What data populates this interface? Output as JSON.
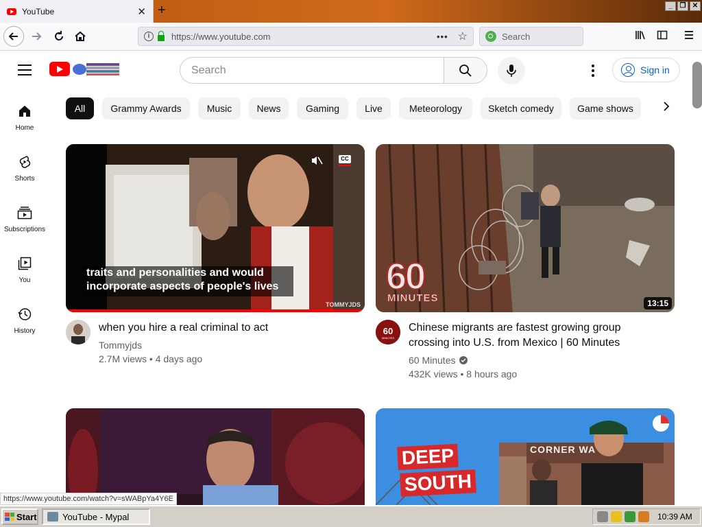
{
  "browser": {
    "tab_title": "YouTube",
    "url": "https://www.youtube.com",
    "search_placeholder": "Search"
  },
  "youtube": {
    "search_placeholder": "Search",
    "sign_in_label": "Sign in",
    "guide": [
      {
        "label": "Home",
        "icon": "home-icon"
      },
      {
        "label": "Shorts",
        "icon": "shorts-icon"
      },
      {
        "label": "Subscriptions",
        "icon": "subscriptions-icon"
      },
      {
        "label": "You",
        "icon": "you-icon"
      },
      {
        "label": "History",
        "icon": "history-icon"
      }
    ],
    "chips": [
      "All",
      "Grammy Awards",
      "Music",
      "News",
      "Gaming",
      "Live",
      "Meteorology",
      "Sketch comedy",
      "Game shows"
    ],
    "videos": [
      {
        "title": "when you hire a real criminal to act",
        "channel": "Tommyjds",
        "stats": "2.7M views • 4 days ago",
        "caption_line1": "traits and personalities and would",
        "caption_line2": "incorporate aspects of people's lives",
        "watermark": "TOMMYJDS"
      },
      {
        "title_line1": "Chinese migrants are fastest growing group",
        "title_line2": "crossing into U.S. from Mexico | 60 Minutes",
        "channel": "60 Minutes",
        "stats": "432K views • 8 hours ago",
        "duration": "13:15",
        "logo_text_big": "60",
        "logo_text_small": "MINUTES"
      },
      {
        "title": ""
      },
      {
        "overlay_line1": "DEEP",
        "overlay_line2": "SOUTH",
        "sign_text": "CORNER WA"
      }
    ]
  },
  "status_url": "https://www.youtube.com/watch?v=sWABpYa4Y6E",
  "taskbar": {
    "start_label": "Start",
    "task_label": "YouTube - Mypal",
    "clock": "10:39 AM"
  }
}
